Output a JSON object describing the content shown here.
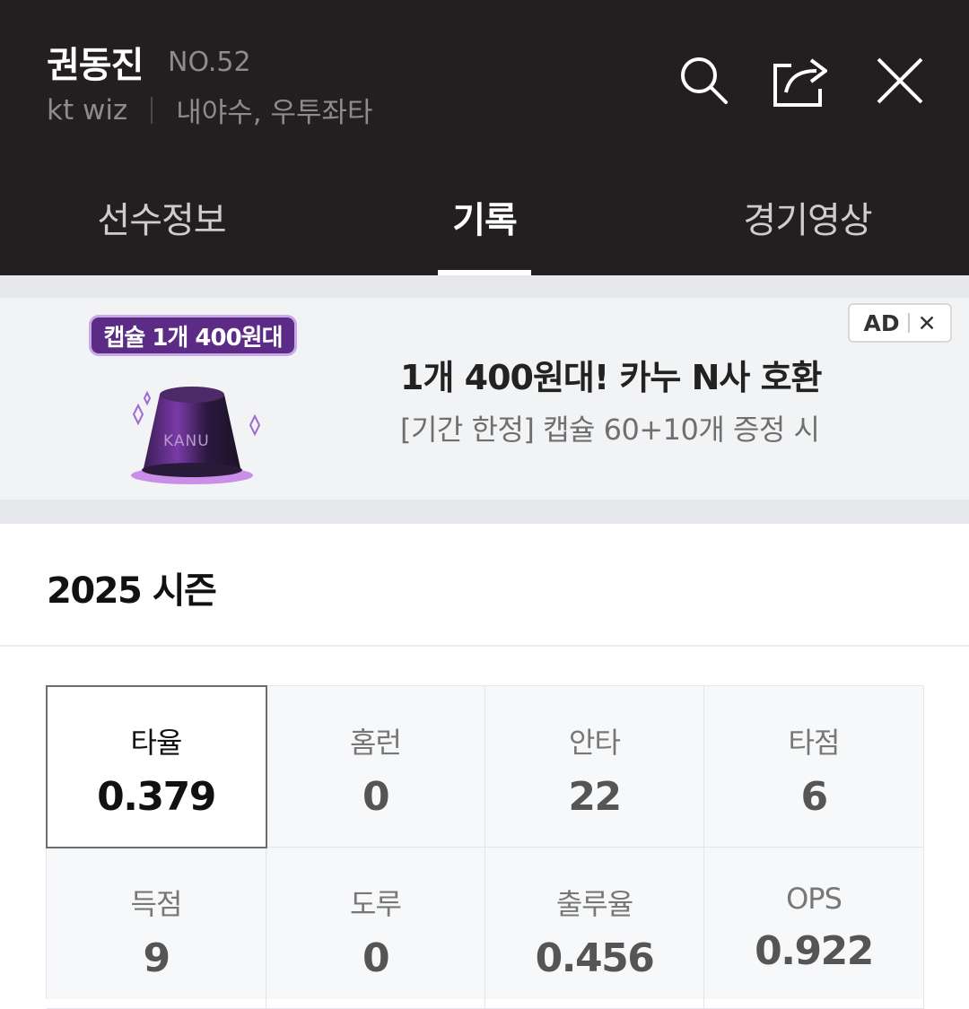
{
  "header": {
    "player_name": "권동진",
    "player_number": "NO.52",
    "team": "kt wiz",
    "positions": "내야수, 우투좌타",
    "icons": [
      "search-icon",
      "share-icon",
      "close-icon"
    ],
    "background": "#231f20"
  },
  "tabs": [
    {
      "label": "선수정보",
      "active": false
    },
    {
      "label": "기록",
      "active": true
    },
    {
      "label": "경기영상",
      "active": false
    }
  ],
  "ad": {
    "badge": "캡슐 1개 400원대",
    "brand": "KANU",
    "title": "1개 400원대! 카누 N사 호환",
    "subtitle": "[기간 한정] 캡슐 60+10개 증정 시",
    "tag_label": "AD",
    "tag_close": "✕",
    "accent": "#5b2b86"
  },
  "season": {
    "title": "2025 시즌"
  },
  "stats": [
    {
      "label": "타율",
      "value": "0.379",
      "selected": true
    },
    {
      "label": "홈런",
      "value": "0"
    },
    {
      "label": "안타",
      "value": "22"
    },
    {
      "label": "타점",
      "value": "6"
    },
    {
      "label": "득점",
      "value": "9"
    },
    {
      "label": "도루",
      "value": "0"
    },
    {
      "label": "출루율",
      "value": "0.456"
    },
    {
      "label": "OPS",
      "value": "0.922"
    }
  ]
}
